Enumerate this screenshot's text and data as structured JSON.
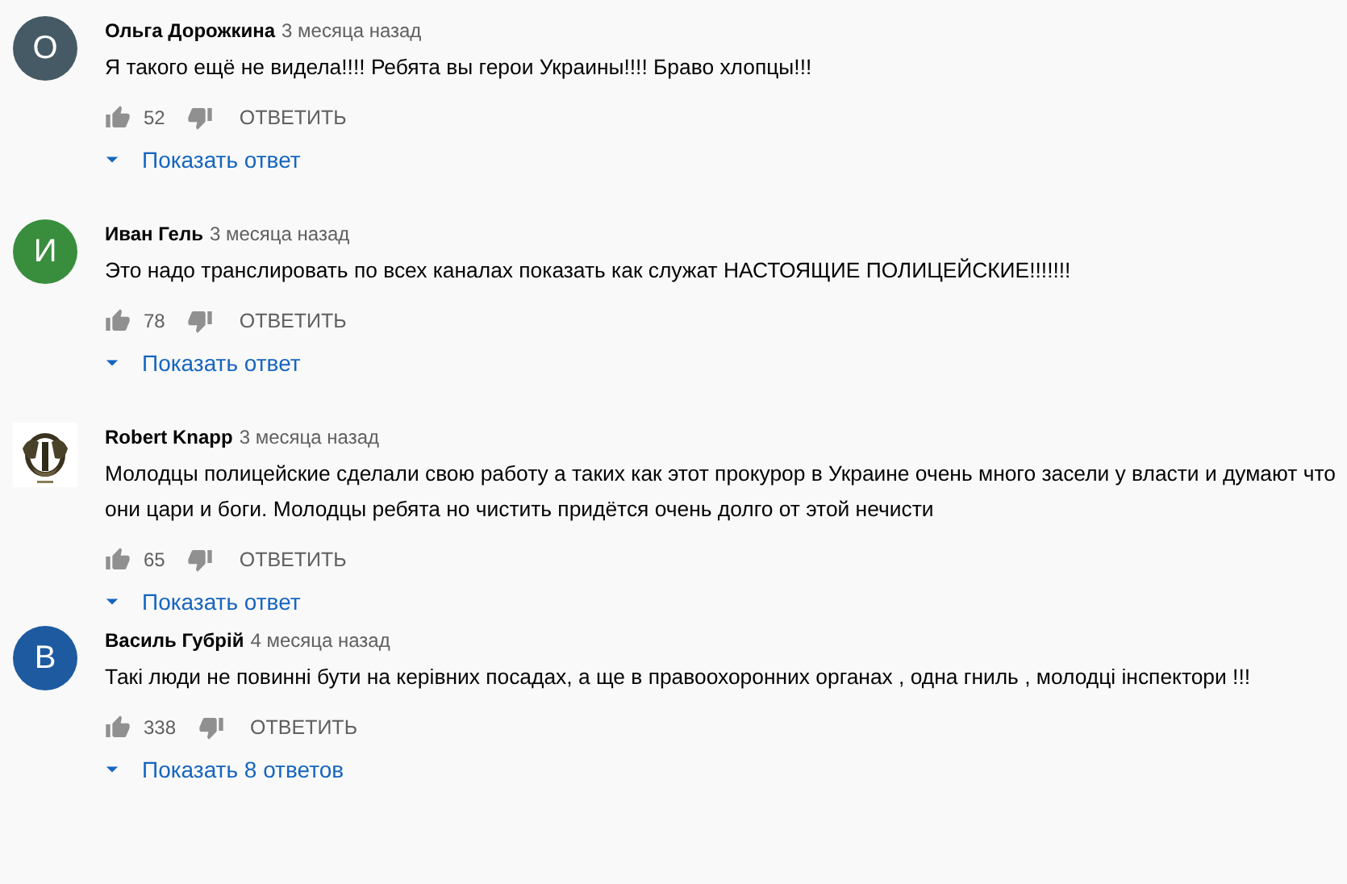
{
  "comments": [
    {
      "avatar": {
        "kind": "letter",
        "letter": "О",
        "color": "#455a64"
      },
      "author": "Ольга Дорожкина",
      "time": "3 месяца назад",
      "text": "Я такого ещё не видела!!!! Ребята вы герои Украины!!!! Браво хлопцы!!!",
      "likes": "52",
      "reply_label": "ОТВЕТИТЬ",
      "replies_label": "Показать ответ"
    },
    {
      "avatar": {
        "kind": "letter",
        "letter": "И",
        "color": "#388e3c"
      },
      "author": "Иван Гель",
      "time": "3 месяца назад",
      "text": "Это надо транслировать по всех каналах показать как служат НАСТОЯЩИЕ  ПОЛИЦЕЙСКИЕ!!!!!!!",
      "likes": "78",
      "reply_label": "ОТВЕТИТЬ",
      "replies_label": "Показать ответ"
    },
    {
      "author": "Robert Knapp",
      "time": "3 месяца назад",
      "text": "Молодцы полицейские сделали свою работу а таких как этот прокурор в Украине очень много засели у власти и думают что они цари и боги. Молодцы ребята но чистить придётся очень долго от этой нечисти",
      "likes": "65",
      "reply_label": "ОТВЕТИТЬ",
      "replies_label": "Показать ответ"
    },
    {
      "avatar": {
        "kind": "letter",
        "letter": "В",
        "color": "#1e5aa0"
      },
      "author": "Василь Губрій",
      "time": "4 месяца назад",
      "text": "Такі люди не повинні бути на керівних посадах, а ще в правоохоронних органах , одна гниль , молодці інспектори !!!",
      "likes": "338",
      "reply_label": "ОТВЕТИТЬ",
      "replies_label": "Показать 8 ответов"
    }
  ]
}
